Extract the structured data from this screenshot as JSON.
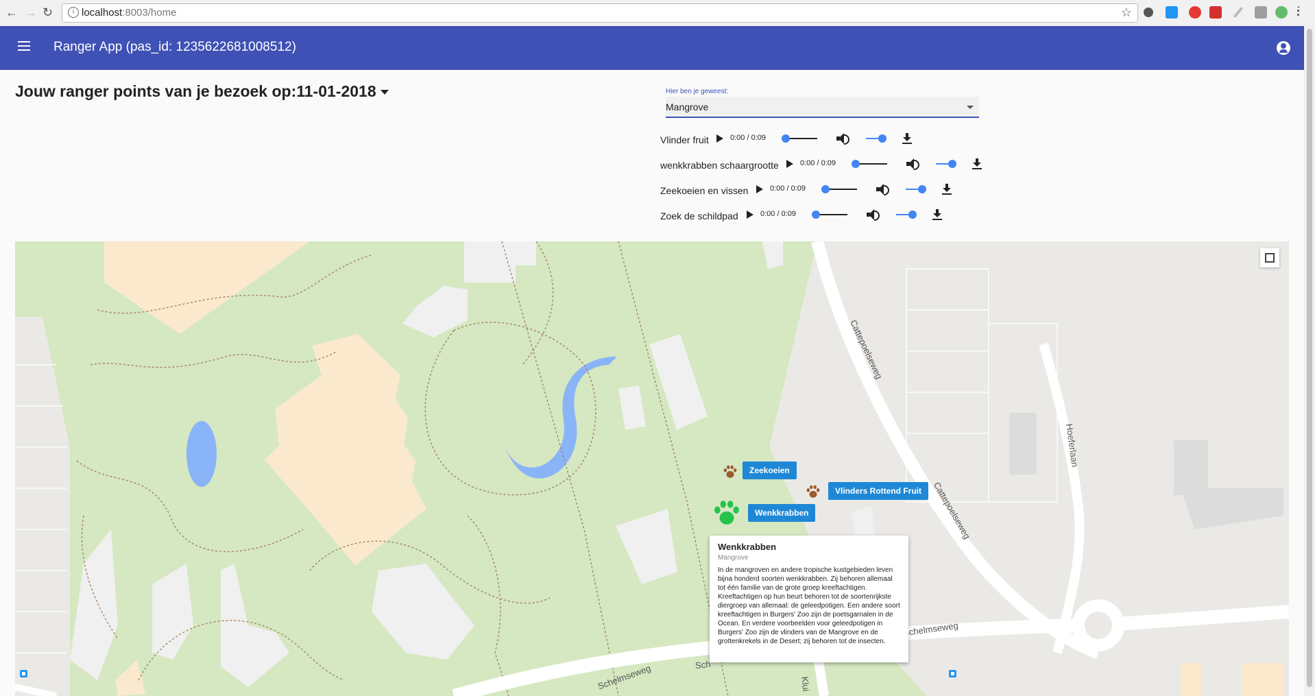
{
  "browser": {
    "url_host": "localhost",
    "url_path": ":8003/home"
  },
  "appbar": {
    "title": "Ranger App (pas_id: 1235622681008512)"
  },
  "heading": {
    "text": "Jouw ranger points van je bezoek op:11-01-2018"
  },
  "location_select": {
    "label": "Hier ben je geweest:",
    "value": "Mangrove"
  },
  "audio_items": [
    {
      "label": "Vlinder fruit",
      "time": "0:00 / 0:09"
    },
    {
      "label": "wenkkrabben schaargrootte",
      "time": "0:00 / 0:09"
    },
    {
      "label": "Zeekoeien en vissen",
      "time": "0:00 / 0:09"
    },
    {
      "label": "Zoek de schildpad",
      "time": "0:00 / 0:09"
    }
  ],
  "map": {
    "markers": [
      {
        "label": "Zeekoeien",
        "color": "#9c5a2e"
      },
      {
        "label": "Vlinders Rottend Fruit",
        "color": "#9c5a2e"
      },
      {
        "label": "Wenkkrabben",
        "color": "#27c24c"
      }
    ],
    "infowindow": {
      "title": "Wenkkrabben",
      "subtitle": "Mangrove",
      "body": "In de mangroven en andere tropische kustgebieden leven bijna honderd soorten wenkkrabben. Zij behoren allemaal tot één familie van de grote groep kreeftachtigen. Kreeftachtigen op hun beurt behoren tot de soortenrijkste diergroep van allemaal: de geleedpotigen. Een andere soort kreeftachtigen in Burgers' Zoo zijn de poetsgarnalen in de Ocean. En verdere voorbeelden voor geleedpotigen in Burgers' Zoo zijn de vlinders van de Mangrove en de grottenkrekels in de Desert; zij behoren tot de insecten."
    },
    "road_labels": {
      "cattepoelseweg_1": "Cattepoelseweg",
      "cattepoelseweg_2": "Cattepoelseweg",
      "hoeferlaan": "Hoeferlaan",
      "schelmseweg_1": "Schelmseweg",
      "schelmseweg_2": "Schelmseweg",
      "schelmseweg_3": "Sch",
      "kluis": "Klui"
    },
    "colors": {
      "park": "#d5e8c1",
      "building_tan": "#fbe9cd",
      "building_gray": "#f0f0f0",
      "water": "#8ab4f8",
      "road": "#ffffff",
      "urban": "#ebe9e6"
    }
  }
}
